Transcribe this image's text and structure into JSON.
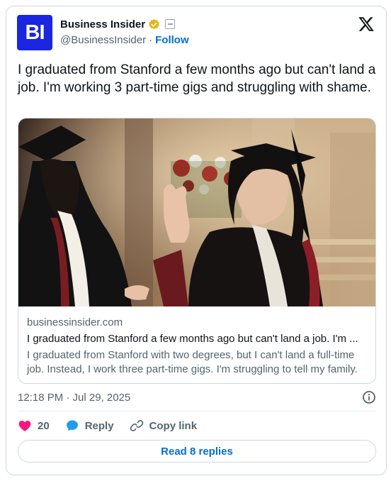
{
  "author": {
    "name": "Business Insider",
    "handle": "@BusinessInsider",
    "separator": "·",
    "follow_label": "Follow",
    "avatar_text": "BI",
    "brand_color": "#1a26e0"
  },
  "tweet": {
    "text": "I graduated from Stanford a few months ago but can't land a job. I'm working 3 part-time gigs and struggling with shame."
  },
  "link_card": {
    "domain": "businessinsider.com",
    "title": "I graduated from Stanford a few months ago but can't land a job. I'm ...",
    "description": "I graduated from Stanford with two degrees, but I can't land a full-time job. Instead, I work three part-time gigs. I'm struggling to tell my family."
  },
  "meta": {
    "timestamp": "12:18 PM · Jul 29, 2025"
  },
  "actions": {
    "like_count": "20",
    "reply_label": "Reply",
    "copy_link_label": "Copy link"
  },
  "footer": {
    "read_replies_label": "Read 8 replies"
  },
  "icons": {
    "verified": "gold-verified-badge",
    "x_logo": "x-logo",
    "info": "info-icon",
    "like": "heart-icon",
    "reply": "speech-bubble-icon",
    "copy_link": "link-icon"
  },
  "colors": {
    "heart": "#f91880",
    "reply_bubble": "#1d9bf0",
    "link_blue": "#006fd6",
    "verified_gold": "#e2b719"
  }
}
